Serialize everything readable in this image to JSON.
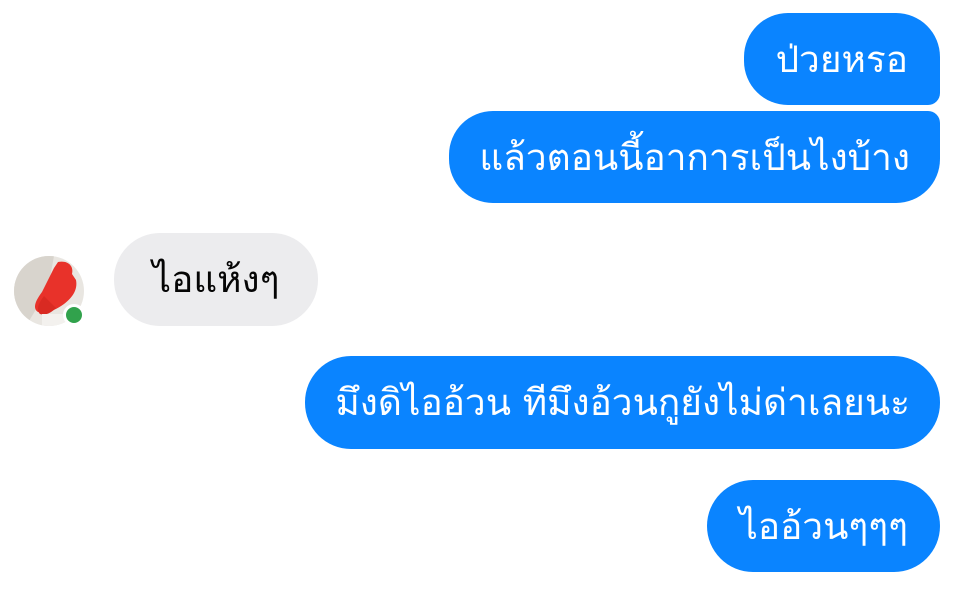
{
  "conversation": {
    "messages": [
      {
        "sender": "me",
        "text": "ป่วยหรอ"
      },
      {
        "sender": "me",
        "text": "แล้วตอนนี้อาการเป็นไงบ้าง"
      },
      {
        "sender": "contact",
        "text": "ไอแห้งๆ"
      },
      {
        "sender": "me",
        "text": "มึงดิไออ้วน ทีมึงอ้วนกูยังไม่ด่าเลยนะ"
      },
      {
        "sender": "me",
        "text": "ไออ้วนๆๆๆ"
      }
    ]
  },
  "contact": {
    "avatar_icon": "profile-photo-redacted",
    "online": true,
    "online_color": "#31a24c"
  },
  "colors": {
    "outgoing_bubble": "#0a84ff",
    "incoming_bubble": "#ececee",
    "outgoing_text": "#ffffff",
    "incoming_text": "#050505"
  }
}
